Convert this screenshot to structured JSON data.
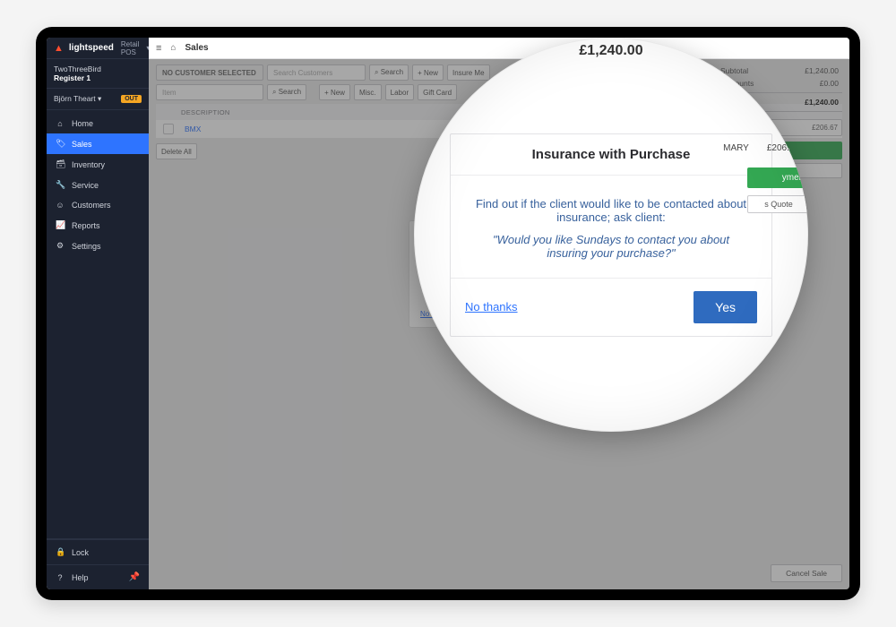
{
  "brand": {
    "name": "lightspeed",
    "module": "Retail POS",
    "caret": "▾"
  },
  "store": {
    "line1": "TwoThreeBird",
    "line2": "Register 1"
  },
  "user": {
    "name": "Björn Theart",
    "caret": "▾",
    "badge": "OUT"
  },
  "nav": {
    "items": [
      {
        "icon": "⌂",
        "label": "Home"
      },
      {
        "icon": "🏷",
        "label": "Sales"
      },
      {
        "icon": "🗃",
        "label": "Inventory"
      },
      {
        "icon": "🔧",
        "label": "Service"
      },
      {
        "icon": "☺",
        "label": "Customers"
      },
      {
        "icon": "📈",
        "label": "Reports"
      },
      {
        "icon": "⚙",
        "label": "Settings"
      }
    ],
    "active_index": 1,
    "lock": "Lock",
    "help": "Help"
  },
  "breadcrumb": {
    "home_icon": "⌂",
    "title": "Sales"
  },
  "customer_bar": {
    "chip": "NO CUSTOMER SELECTED",
    "search_placeholder": "Search Customers",
    "search_btn": "⌕ Search",
    "new_btn": "+ New",
    "insure_btn": "Insure Me"
  },
  "item_bar": {
    "input_placeholder": "Item",
    "search_btn": "⌕ Search",
    "new_btn": "+ New",
    "misc_btn": "Misc.",
    "labor_btn": "Labor",
    "gift_btn": "Gift Card"
  },
  "grid": {
    "header": "DESCRIPTION",
    "row1": "BMX",
    "delete_all": "Delete All"
  },
  "totals": {
    "subtotal_label": "Subtotal",
    "subtotal": "£1,240.00",
    "discounts_label": "Discounts",
    "discounts": "£0.00",
    "total_label": "Total",
    "total": "£1,240.00",
    "summary_label": "MARY",
    "summary_value": "£206.67",
    "payment_btn": "yment",
    "quote_btn": "s Quote",
    "cancel_btn": "Cancel Sale"
  },
  "mini_modal": {
    "line1": "Find out if",
    "line2": "\"Would yo",
    "link": "No thanks"
  },
  "big_total_peek": "£1,240.00",
  "modal": {
    "title": "Insurance with Purchase",
    "lead": "Find out if the client would like to be contacted about insurance; ask client:",
    "quote": "\"Would you like Sundays to contact you about insuring your purchase?\"",
    "no": "No thanks",
    "yes": "Yes"
  },
  "ghost": {
    "summary_label": "MARY",
    "summary_value": "£206.67",
    "payment": "yment",
    "quote": "s Quote"
  }
}
